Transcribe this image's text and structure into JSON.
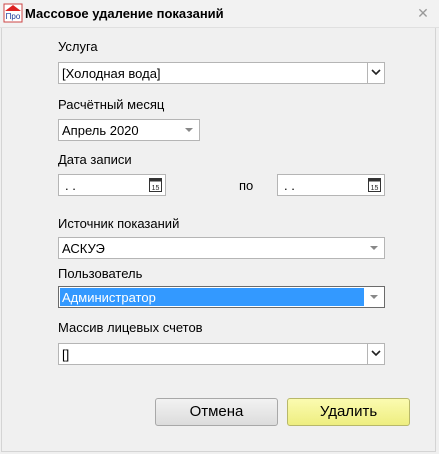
{
  "window": {
    "title": "Массовое удаление показаний",
    "app_icon_text": "Про",
    "close_icon": "close-icon"
  },
  "form": {
    "service": {
      "label": "Услуга",
      "value": "[Холодная вода]"
    },
    "month": {
      "label": "Расчётный месяц",
      "value": "Апрель 2020"
    },
    "record_date": {
      "label": "Дата записи",
      "from_value": " .  .",
      "separator": "по",
      "to_value": " .  .",
      "calendar_icon_text": "15"
    },
    "source": {
      "label": "Источник показаний",
      "value": "АСКУЭ"
    },
    "user": {
      "label": "Пользователь",
      "value": "Администратор"
    },
    "accounts": {
      "label": "Массив лицевых счетов",
      "value": "[]"
    }
  },
  "buttons": {
    "cancel": "Отмена",
    "delete": "Удалить"
  },
  "colors": {
    "selection": "#3399ff",
    "delete_button": "#f4f49a",
    "cancel_button": "#e6e6e6",
    "background": "#f0f0f0"
  }
}
